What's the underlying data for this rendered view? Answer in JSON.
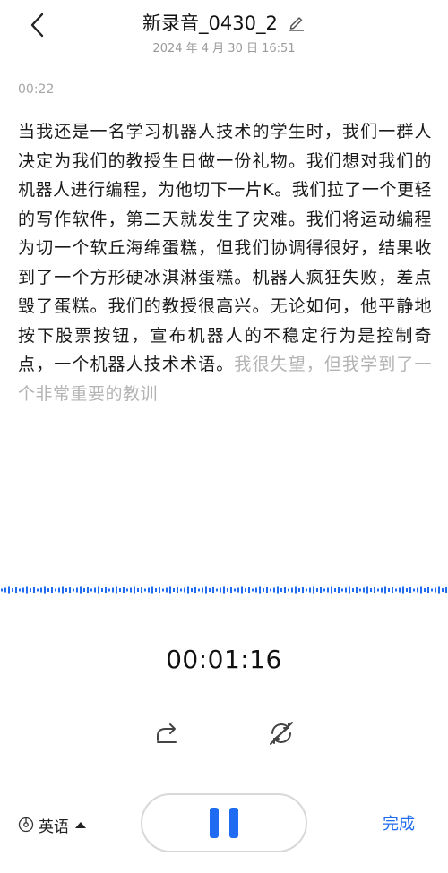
{
  "header": {
    "title": "新录音_0430_2",
    "subtitle": "2024 年 4 月 30 日 16:51",
    "icons": {
      "back": "chevron-left-icon",
      "edit": "pencil-icon"
    }
  },
  "segment": {
    "timestamp": "00:22",
    "text_final": "当我还是一名学习机器人技术的学生时，我们一群人决定为我们的教授生日做一份礼物。我们想对我们的机器人进行编程，为他切下一片K。我们拉了一个更轻的写作软件，第二天就发生了灾难。我们将运动编程为切一个软丘海绵蛋糕，但我们协调得很好，结果收到了一个方形硬冰淇淋蛋糕。机器人疯狂失败，差点毁了蛋糕。我们的教授很高兴。无论如何，他平静地按下股票按钮，宣布机器人的不稳定行为是控制奇点，一个机器人技术术语。",
    "text_pending": "我很失望，但我学到了一个非常重要的教训"
  },
  "recorder": {
    "elapsed": "00:01:16",
    "language": "英语",
    "done_label": "完成",
    "accent_color": "#1f6cf2",
    "icons": {
      "share": "share-icon",
      "translate_off": "translate-off-icon",
      "language": "globe-icon",
      "caret": "caret-up-icon",
      "pause": "pause-icon"
    }
  }
}
